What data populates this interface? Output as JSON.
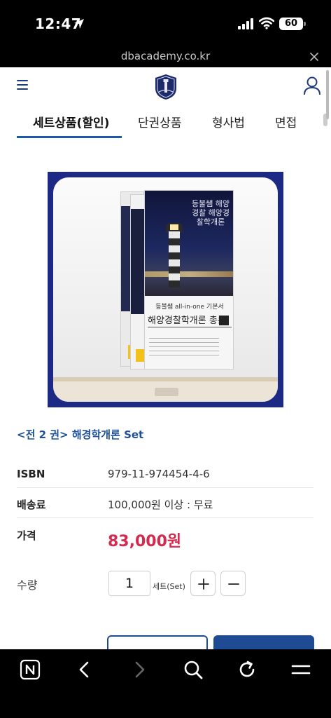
{
  "status_bar": {
    "time": "12:47",
    "battery": "60"
  },
  "browser": {
    "url": "dbacademy.co.kr"
  },
  "tabs": [
    {
      "label": "세트상품(할인)"
    },
    {
      "label": "단권상품"
    },
    {
      "label": "형사법"
    },
    {
      "label": "면접"
    }
  ],
  "product": {
    "name": "<전 2 권> 해경학개론 Set",
    "cover_series": "등불쌤 all-in-one 기본서",
    "cover_title": "해양경찰학개론 총론",
    "cover_top_title": "등불쌤 해양경찰 해양경찰학개론"
  },
  "info": {
    "isbn_label": "ISBN",
    "isbn_value": "979-11-974454-4-6",
    "shipping_label": "배송료",
    "shipping_value": "100,000원 이상 : 무료",
    "price_label": "가격",
    "price_value": "83,000원",
    "qty_label": "수량",
    "qty_value": "1",
    "qty_unit": "세트(Set)"
  },
  "colors": {
    "accent_blue": "#1e5aa8",
    "price_red": "#d32a4e",
    "product_frame": "#1c2a86"
  }
}
